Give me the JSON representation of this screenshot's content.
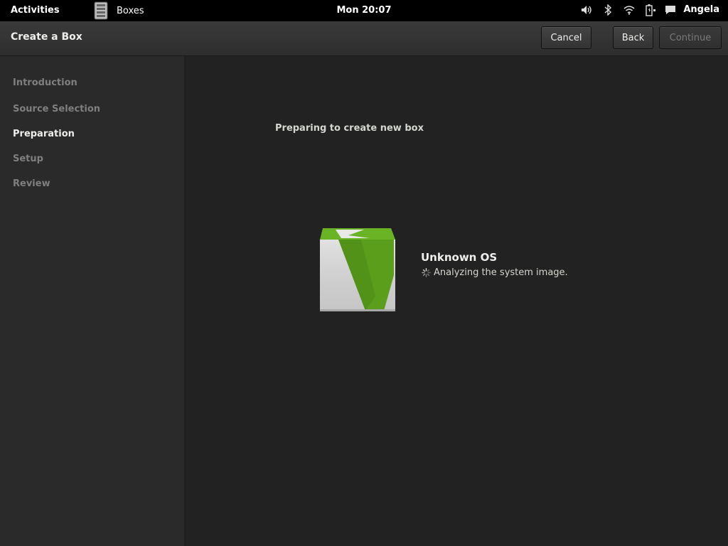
{
  "topbar": {
    "activities": "Activities",
    "app_name": "Boxes",
    "clock": "Mon 20:07",
    "status_icons": [
      "volume-icon",
      "bluetooth-icon",
      "wifi-icon",
      "battery-icon"
    ],
    "user_name": "Angela"
  },
  "header": {
    "title": "Create a Box",
    "cancel_label": "Cancel",
    "back_label": "Back",
    "continue_label": "Continue"
  },
  "sidebar": {
    "steps": [
      {
        "label": "Introduction",
        "active": false
      },
      {
        "label": "Source Selection",
        "active": false
      },
      {
        "label": "Preparation",
        "active": true
      },
      {
        "label": "Setup",
        "active": false
      },
      {
        "label": "Review",
        "active": false
      }
    ]
  },
  "main": {
    "heading": "Preparing to create new box",
    "os_name": "Unknown OS",
    "status_text": "Analyzing the system image."
  },
  "colors": {
    "accent_green": "#5a9e1c",
    "background": "#222222",
    "sidebar": "#2a2a2a"
  }
}
